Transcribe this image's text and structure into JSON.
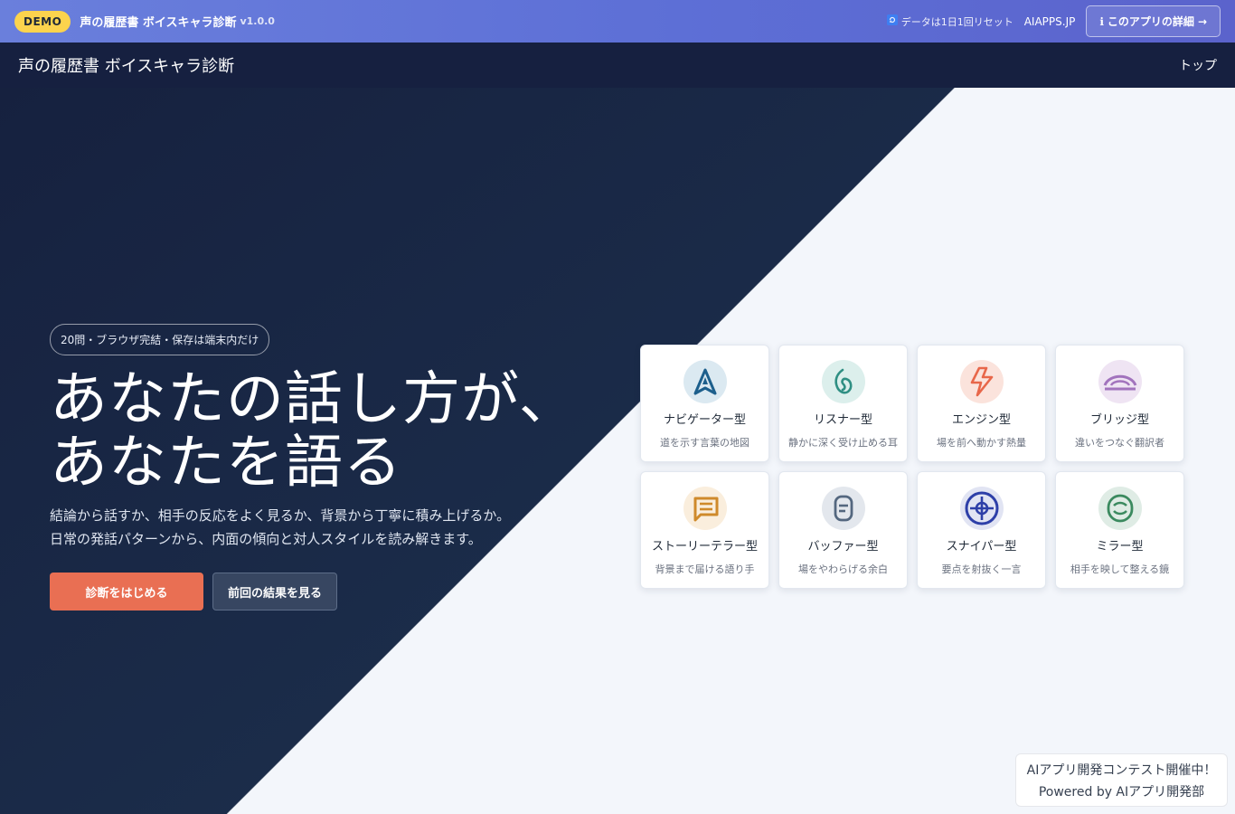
{
  "demo_bar": {
    "badge": "DEMO",
    "title": "声の履歴書 ボイスキャラ診断",
    "version": "v1.0.0",
    "reset_note": "データは1日1回リセット",
    "site_link": "AIAPPS.JP",
    "details_label": "このアプリの詳細",
    "details_arrow": "→"
  },
  "nav": {
    "title": "声の履歴書 ボイスキャラ診断",
    "top_link": "トップ"
  },
  "hero": {
    "pill": "20問・ブラウザ完結・保存は端末内だけ",
    "headline_line1": "あなたの話し方が、",
    "headline_line2": "あなたを語る",
    "sub_line1": "結論から話すか、相手の反応をよく見るか、背景から丁寧に積み上げるか。",
    "sub_line2": "日常の発話パターンから、内面の傾向と対人スタイルを読み解きます。",
    "primary_button": "診断をはじめる",
    "secondary_button": "前回の結果を見る"
  },
  "types": [
    {
      "name": "ナビゲーター型",
      "desc": "道を示す言葉の地図",
      "icon": "navigator-icon",
      "color": "#1c5f8c",
      "bg": "#dbe9f1"
    },
    {
      "name": "リスナー型",
      "desc": "静かに深く受け止める耳",
      "icon": "listener-icon",
      "color": "#2f8f83",
      "bg": "#dcefec"
    },
    {
      "name": "エンジン型",
      "desc": "場を前へ動かす熱量",
      "icon": "engine-icon",
      "color": "#e8674a",
      "bg": "#fbe3dc"
    },
    {
      "name": "ブリッジ型",
      "desc": "違いをつなぐ翻訳者",
      "icon": "bridge-icon",
      "color": "#a273bd",
      "bg": "#efe4f3"
    },
    {
      "name": "ストーリーテラー型",
      "desc": "背景まで届ける語り手",
      "icon": "storyteller-icon",
      "color": "#cf8a2b",
      "bg": "#faeedd"
    },
    {
      "name": "バッファー型",
      "desc": "場をやわらげる余白",
      "icon": "buffer-icon",
      "color": "#54677f",
      "bg": "#e3e7ed"
    },
    {
      "name": "スナイパー型",
      "desc": "要点を射抜く一言",
      "icon": "sniper-icon",
      "color": "#2d3fa8",
      "bg": "#e1e4f3"
    },
    {
      "name": "ミラー型",
      "desc": "相手を映して整える鏡",
      "icon": "mirror-icon",
      "color": "#3b8a5f",
      "bg": "#dfece5"
    }
  ],
  "contest": {
    "line1": "AIアプリ開発コンテスト開催中！",
    "line2": "Powered by AIアプリ開発部"
  }
}
